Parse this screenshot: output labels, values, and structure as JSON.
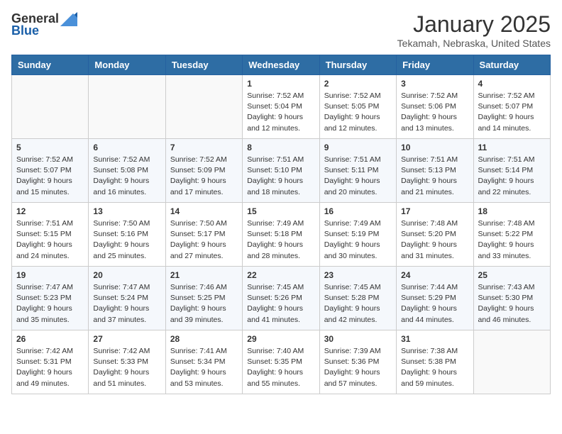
{
  "logo": {
    "general": "General",
    "blue": "Blue"
  },
  "title": {
    "month": "January 2025",
    "location": "Tekamah, Nebraska, United States"
  },
  "headers": [
    "Sunday",
    "Monday",
    "Tuesday",
    "Wednesday",
    "Thursday",
    "Friday",
    "Saturday"
  ],
  "weeks": [
    [
      {
        "day": "",
        "info": ""
      },
      {
        "day": "",
        "info": ""
      },
      {
        "day": "",
        "info": ""
      },
      {
        "day": "1",
        "info": "Sunrise: 7:52 AM\nSunset: 5:04 PM\nDaylight: 9 hours and 12 minutes."
      },
      {
        "day": "2",
        "info": "Sunrise: 7:52 AM\nSunset: 5:05 PM\nDaylight: 9 hours and 12 minutes."
      },
      {
        "day": "3",
        "info": "Sunrise: 7:52 AM\nSunset: 5:06 PM\nDaylight: 9 hours and 13 minutes."
      },
      {
        "day": "4",
        "info": "Sunrise: 7:52 AM\nSunset: 5:07 PM\nDaylight: 9 hours and 14 minutes."
      }
    ],
    [
      {
        "day": "5",
        "info": "Sunrise: 7:52 AM\nSunset: 5:07 PM\nDaylight: 9 hours and 15 minutes."
      },
      {
        "day": "6",
        "info": "Sunrise: 7:52 AM\nSunset: 5:08 PM\nDaylight: 9 hours and 16 minutes."
      },
      {
        "day": "7",
        "info": "Sunrise: 7:52 AM\nSunset: 5:09 PM\nDaylight: 9 hours and 17 minutes."
      },
      {
        "day": "8",
        "info": "Sunrise: 7:51 AM\nSunset: 5:10 PM\nDaylight: 9 hours and 18 minutes."
      },
      {
        "day": "9",
        "info": "Sunrise: 7:51 AM\nSunset: 5:11 PM\nDaylight: 9 hours and 20 minutes."
      },
      {
        "day": "10",
        "info": "Sunrise: 7:51 AM\nSunset: 5:13 PM\nDaylight: 9 hours and 21 minutes."
      },
      {
        "day": "11",
        "info": "Sunrise: 7:51 AM\nSunset: 5:14 PM\nDaylight: 9 hours and 22 minutes."
      }
    ],
    [
      {
        "day": "12",
        "info": "Sunrise: 7:51 AM\nSunset: 5:15 PM\nDaylight: 9 hours and 24 minutes."
      },
      {
        "day": "13",
        "info": "Sunrise: 7:50 AM\nSunset: 5:16 PM\nDaylight: 9 hours and 25 minutes."
      },
      {
        "day": "14",
        "info": "Sunrise: 7:50 AM\nSunset: 5:17 PM\nDaylight: 9 hours and 27 minutes."
      },
      {
        "day": "15",
        "info": "Sunrise: 7:49 AM\nSunset: 5:18 PM\nDaylight: 9 hours and 28 minutes."
      },
      {
        "day": "16",
        "info": "Sunrise: 7:49 AM\nSunset: 5:19 PM\nDaylight: 9 hours and 30 minutes."
      },
      {
        "day": "17",
        "info": "Sunrise: 7:48 AM\nSunset: 5:20 PM\nDaylight: 9 hours and 31 minutes."
      },
      {
        "day": "18",
        "info": "Sunrise: 7:48 AM\nSunset: 5:22 PM\nDaylight: 9 hours and 33 minutes."
      }
    ],
    [
      {
        "day": "19",
        "info": "Sunrise: 7:47 AM\nSunset: 5:23 PM\nDaylight: 9 hours and 35 minutes."
      },
      {
        "day": "20",
        "info": "Sunrise: 7:47 AM\nSunset: 5:24 PM\nDaylight: 9 hours and 37 minutes."
      },
      {
        "day": "21",
        "info": "Sunrise: 7:46 AM\nSunset: 5:25 PM\nDaylight: 9 hours and 39 minutes."
      },
      {
        "day": "22",
        "info": "Sunrise: 7:45 AM\nSunset: 5:26 PM\nDaylight: 9 hours and 41 minutes."
      },
      {
        "day": "23",
        "info": "Sunrise: 7:45 AM\nSunset: 5:28 PM\nDaylight: 9 hours and 42 minutes."
      },
      {
        "day": "24",
        "info": "Sunrise: 7:44 AM\nSunset: 5:29 PM\nDaylight: 9 hours and 44 minutes."
      },
      {
        "day": "25",
        "info": "Sunrise: 7:43 AM\nSunset: 5:30 PM\nDaylight: 9 hours and 46 minutes."
      }
    ],
    [
      {
        "day": "26",
        "info": "Sunrise: 7:42 AM\nSunset: 5:31 PM\nDaylight: 9 hours and 49 minutes."
      },
      {
        "day": "27",
        "info": "Sunrise: 7:42 AM\nSunset: 5:33 PM\nDaylight: 9 hours and 51 minutes."
      },
      {
        "day": "28",
        "info": "Sunrise: 7:41 AM\nSunset: 5:34 PM\nDaylight: 9 hours and 53 minutes."
      },
      {
        "day": "29",
        "info": "Sunrise: 7:40 AM\nSunset: 5:35 PM\nDaylight: 9 hours and 55 minutes."
      },
      {
        "day": "30",
        "info": "Sunrise: 7:39 AM\nSunset: 5:36 PM\nDaylight: 9 hours and 57 minutes."
      },
      {
        "day": "31",
        "info": "Sunrise: 7:38 AM\nSunset: 5:38 PM\nDaylight: 9 hours and 59 minutes."
      },
      {
        "day": "",
        "info": ""
      }
    ]
  ]
}
